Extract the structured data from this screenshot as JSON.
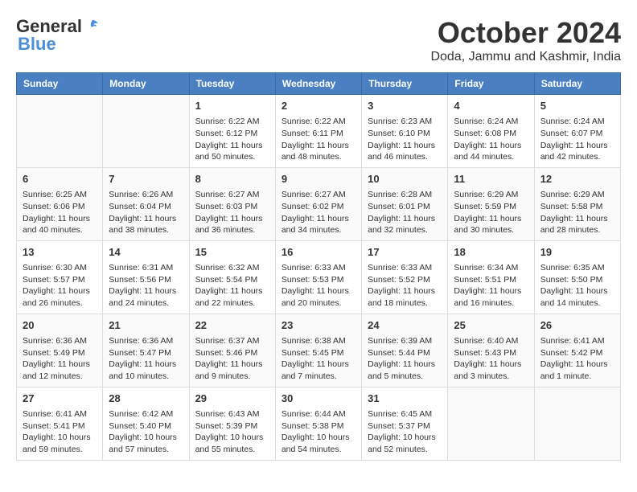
{
  "logo": {
    "general": "General",
    "blue": "Blue"
  },
  "title": "October 2024",
  "location": "Doda, Jammu and Kashmir, India",
  "days_of_week": [
    "Sunday",
    "Monday",
    "Tuesday",
    "Wednesday",
    "Thursday",
    "Friday",
    "Saturday"
  ],
  "weeks": [
    [
      {
        "day": "",
        "sunrise": "",
        "sunset": "",
        "daylight": ""
      },
      {
        "day": "",
        "sunrise": "",
        "sunset": "",
        "daylight": ""
      },
      {
        "day": "1",
        "sunrise": "Sunrise: 6:22 AM",
        "sunset": "Sunset: 6:12 PM",
        "daylight": "Daylight: 11 hours and 50 minutes."
      },
      {
        "day": "2",
        "sunrise": "Sunrise: 6:22 AM",
        "sunset": "Sunset: 6:11 PM",
        "daylight": "Daylight: 11 hours and 48 minutes."
      },
      {
        "day": "3",
        "sunrise": "Sunrise: 6:23 AM",
        "sunset": "Sunset: 6:10 PM",
        "daylight": "Daylight: 11 hours and 46 minutes."
      },
      {
        "day": "4",
        "sunrise": "Sunrise: 6:24 AM",
        "sunset": "Sunset: 6:08 PM",
        "daylight": "Daylight: 11 hours and 44 minutes."
      },
      {
        "day": "5",
        "sunrise": "Sunrise: 6:24 AM",
        "sunset": "Sunset: 6:07 PM",
        "daylight": "Daylight: 11 hours and 42 minutes."
      }
    ],
    [
      {
        "day": "6",
        "sunrise": "Sunrise: 6:25 AM",
        "sunset": "Sunset: 6:06 PM",
        "daylight": "Daylight: 11 hours and 40 minutes."
      },
      {
        "day": "7",
        "sunrise": "Sunrise: 6:26 AM",
        "sunset": "Sunset: 6:04 PM",
        "daylight": "Daylight: 11 hours and 38 minutes."
      },
      {
        "day": "8",
        "sunrise": "Sunrise: 6:27 AM",
        "sunset": "Sunset: 6:03 PM",
        "daylight": "Daylight: 11 hours and 36 minutes."
      },
      {
        "day": "9",
        "sunrise": "Sunrise: 6:27 AM",
        "sunset": "Sunset: 6:02 PM",
        "daylight": "Daylight: 11 hours and 34 minutes."
      },
      {
        "day": "10",
        "sunrise": "Sunrise: 6:28 AM",
        "sunset": "Sunset: 6:01 PM",
        "daylight": "Daylight: 11 hours and 32 minutes."
      },
      {
        "day": "11",
        "sunrise": "Sunrise: 6:29 AM",
        "sunset": "Sunset: 5:59 PM",
        "daylight": "Daylight: 11 hours and 30 minutes."
      },
      {
        "day": "12",
        "sunrise": "Sunrise: 6:29 AM",
        "sunset": "Sunset: 5:58 PM",
        "daylight": "Daylight: 11 hours and 28 minutes."
      }
    ],
    [
      {
        "day": "13",
        "sunrise": "Sunrise: 6:30 AM",
        "sunset": "Sunset: 5:57 PM",
        "daylight": "Daylight: 11 hours and 26 minutes."
      },
      {
        "day": "14",
        "sunrise": "Sunrise: 6:31 AM",
        "sunset": "Sunset: 5:56 PM",
        "daylight": "Daylight: 11 hours and 24 minutes."
      },
      {
        "day": "15",
        "sunrise": "Sunrise: 6:32 AM",
        "sunset": "Sunset: 5:54 PM",
        "daylight": "Daylight: 11 hours and 22 minutes."
      },
      {
        "day": "16",
        "sunrise": "Sunrise: 6:33 AM",
        "sunset": "Sunset: 5:53 PM",
        "daylight": "Daylight: 11 hours and 20 minutes."
      },
      {
        "day": "17",
        "sunrise": "Sunrise: 6:33 AM",
        "sunset": "Sunset: 5:52 PM",
        "daylight": "Daylight: 11 hours and 18 minutes."
      },
      {
        "day": "18",
        "sunrise": "Sunrise: 6:34 AM",
        "sunset": "Sunset: 5:51 PM",
        "daylight": "Daylight: 11 hours and 16 minutes."
      },
      {
        "day": "19",
        "sunrise": "Sunrise: 6:35 AM",
        "sunset": "Sunset: 5:50 PM",
        "daylight": "Daylight: 11 hours and 14 minutes."
      }
    ],
    [
      {
        "day": "20",
        "sunrise": "Sunrise: 6:36 AM",
        "sunset": "Sunset: 5:49 PM",
        "daylight": "Daylight: 11 hours and 12 minutes."
      },
      {
        "day": "21",
        "sunrise": "Sunrise: 6:36 AM",
        "sunset": "Sunset: 5:47 PM",
        "daylight": "Daylight: 11 hours and 10 minutes."
      },
      {
        "day": "22",
        "sunrise": "Sunrise: 6:37 AM",
        "sunset": "Sunset: 5:46 PM",
        "daylight": "Daylight: 11 hours and 9 minutes."
      },
      {
        "day": "23",
        "sunrise": "Sunrise: 6:38 AM",
        "sunset": "Sunset: 5:45 PM",
        "daylight": "Daylight: 11 hours and 7 minutes."
      },
      {
        "day": "24",
        "sunrise": "Sunrise: 6:39 AM",
        "sunset": "Sunset: 5:44 PM",
        "daylight": "Daylight: 11 hours and 5 minutes."
      },
      {
        "day": "25",
        "sunrise": "Sunrise: 6:40 AM",
        "sunset": "Sunset: 5:43 PM",
        "daylight": "Daylight: 11 hours and 3 minutes."
      },
      {
        "day": "26",
        "sunrise": "Sunrise: 6:41 AM",
        "sunset": "Sunset: 5:42 PM",
        "daylight": "Daylight: 11 hours and 1 minute."
      }
    ],
    [
      {
        "day": "27",
        "sunrise": "Sunrise: 6:41 AM",
        "sunset": "Sunset: 5:41 PM",
        "daylight": "Daylight: 10 hours and 59 minutes."
      },
      {
        "day": "28",
        "sunrise": "Sunrise: 6:42 AM",
        "sunset": "Sunset: 5:40 PM",
        "daylight": "Daylight: 10 hours and 57 minutes."
      },
      {
        "day": "29",
        "sunrise": "Sunrise: 6:43 AM",
        "sunset": "Sunset: 5:39 PM",
        "daylight": "Daylight: 10 hours and 55 minutes."
      },
      {
        "day": "30",
        "sunrise": "Sunrise: 6:44 AM",
        "sunset": "Sunset: 5:38 PM",
        "daylight": "Daylight: 10 hours and 54 minutes."
      },
      {
        "day": "31",
        "sunrise": "Sunrise: 6:45 AM",
        "sunset": "Sunset: 5:37 PM",
        "daylight": "Daylight: 10 hours and 52 minutes."
      },
      {
        "day": "",
        "sunrise": "",
        "sunset": "",
        "daylight": ""
      },
      {
        "day": "",
        "sunrise": "",
        "sunset": "",
        "daylight": ""
      }
    ]
  ]
}
